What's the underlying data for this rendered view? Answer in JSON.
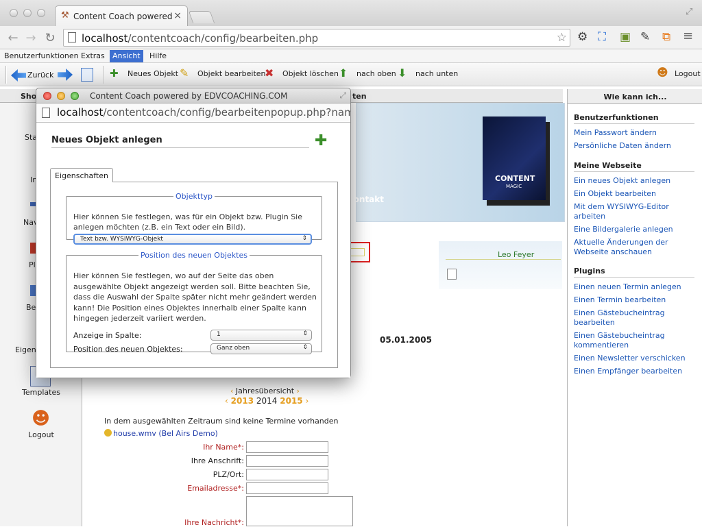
{
  "browser": {
    "tab_title": "Content Coach powered by",
    "url_host": "localhost",
    "url_path": "/contentcoach/config/bearbeiten.php"
  },
  "menu": [
    "Benutzerfunktionen",
    "Extras",
    "Ansicht",
    "Hilfe"
  ],
  "toolbar": {
    "back": "Zurück",
    "new_obj": "Neues Objekt",
    "edit_obj": "Objekt bearbeiten",
    "delete_obj": "Objekt löschen",
    "up": "nach oben",
    "down": "nach unten",
    "logout": "Logout"
  },
  "left_panel": {
    "head": "Sho",
    "items": [
      "Sta",
      "In",
      "Nav",
      "Pl",
      "Be",
      "Eigen",
      "Templates",
      "Logout"
    ]
  },
  "center": {
    "head_fragment": "ten",
    "kontakt": "kontakt",
    "leo": "Leo Feyer",
    "date": "05.01.2005",
    "year_overview": "Jahresübersicht",
    "years": [
      "2013",
      "2014",
      "2015"
    ],
    "no_events": "In dem ausgewählten Zeitraum sind keine Termine vorhanden",
    "video_link": "house.wmv (Bel Airs Demo)",
    "form": {
      "name": "Ihr Name*:",
      "address": "Ihre Anschrift:",
      "plz": "PLZ/Ort:",
      "email": "Emailadresse*:",
      "message": "Ihre Nachricht*:"
    },
    "box_title": "CONTENT",
    "box_sub": "MAGIC"
  },
  "right_panel": {
    "head": "Wie kann ich...",
    "sections": [
      {
        "title": "Benutzerfunktionen",
        "links": [
          "Mein Passwort ändern",
          "Persönliche Daten ändern"
        ]
      },
      {
        "title": "Meine Webseite",
        "links": [
          "Ein neues Objekt anlegen",
          "Ein Objekt bearbeiten",
          "Mit dem WYSIWYG-Editor arbeiten",
          "Eine Bildergalerie anlegen",
          "Aktuelle Änderungen der Webseite anschauen"
        ]
      },
      {
        "title": "Plugins",
        "links": [
          "Einen neuen Termin anlegen",
          "Einen Termin bearbeiten",
          "Einen Gästebucheintrag bearbeiten",
          "Einen Gästebucheintrag kommentieren",
          "Einen Newsletter verschicken",
          "Einen Empfänger bearbeiten"
        ]
      }
    ]
  },
  "popup": {
    "title": "Content Coach powered by EDVCOACHING.COM",
    "url_host": "localhost",
    "url_path": "/contentcoach/config/bearbeitenpopup.php?nam=...",
    "heading": "Neues Objekt anlegen",
    "tab": "Eigenschaften",
    "fs1_legend": "Objekttyp",
    "fs1_text": "Hier können Sie festlegen, was für ein Objekt bzw. Plugin Sie anlegen möchten (z.B. ein Text oder ein Bild).",
    "fs1_select": "Text bzw. WYSIWYG-Objekt",
    "fs2_legend": "Position des neuen Objektes",
    "fs2_text": "Hier können Sie festlegen, wo auf der Seite das oben ausgewählte Objekt angezeigt werden soll. Bitte beachten Sie, dass die Auswahl der Spalte später nicht mehr geändert werden kann! Die Position eines Objektes innerhalb einer Spalte kann hingegen jederzeit variiert werden.",
    "column_label": "Anzeige in Spalte:",
    "column_value": "1",
    "position_label": "Position des neuen Objektes:",
    "position_value": "Ganz oben"
  }
}
